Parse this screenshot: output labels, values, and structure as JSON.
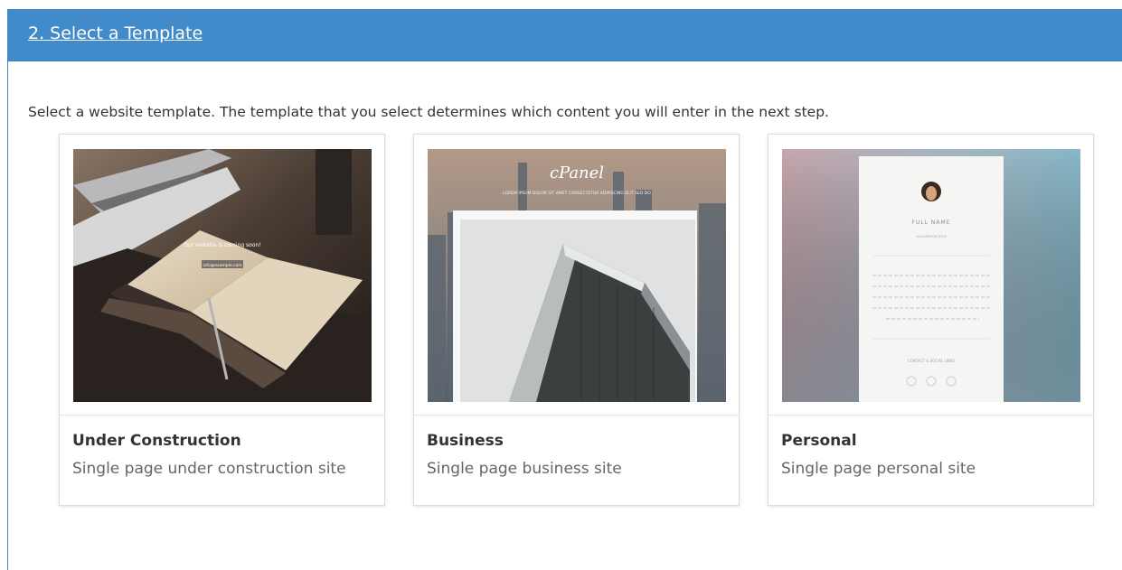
{
  "section": {
    "title": "2. Select a Template",
    "intro": "Select a website template. The template that you select determines which content you will enter in the next step."
  },
  "templates": [
    {
      "title": "Under Construction",
      "description": "Single page under construction site",
      "preview_headline": "Our website is coming soon!",
      "preview_contact": "info@example.com"
    },
    {
      "title": "Business",
      "description": "Single page business site",
      "preview_brand": "cPanel",
      "preview_tagline": "LOREM IPSUM DOLOR SIT AMET CONSECTETUR ADIPISCING ELIT SED DO"
    },
    {
      "title": "Personal",
      "description": "Single page personal site",
      "preview_name": "FULL NAME",
      "preview_role": "OCCUPATION TITLE",
      "preview_contact": "CONTACT & SOCIAL LINKS"
    }
  ],
  "colors": {
    "header_bg": "#428bca",
    "header_text": "#ffffff",
    "title_text": "#333333",
    "desc_text": "#666666"
  }
}
